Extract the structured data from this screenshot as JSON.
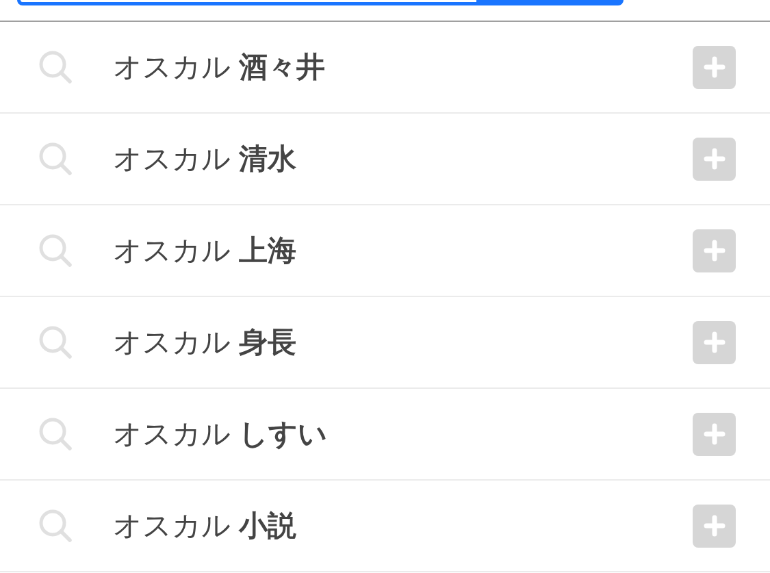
{
  "search_bar": {
    "focused": true
  },
  "suggestions": [
    {
      "text": "オスカル **酒々井**"
    },
    {
      "text": "オスカル **清水**"
    },
    {
      "text": "オスカル **上海**"
    },
    {
      "text": "オスカル **身長**"
    },
    {
      "text": "オスカル **しすい**"
    },
    {
      "text": "オスカル **小説**"
    }
  ]
}
